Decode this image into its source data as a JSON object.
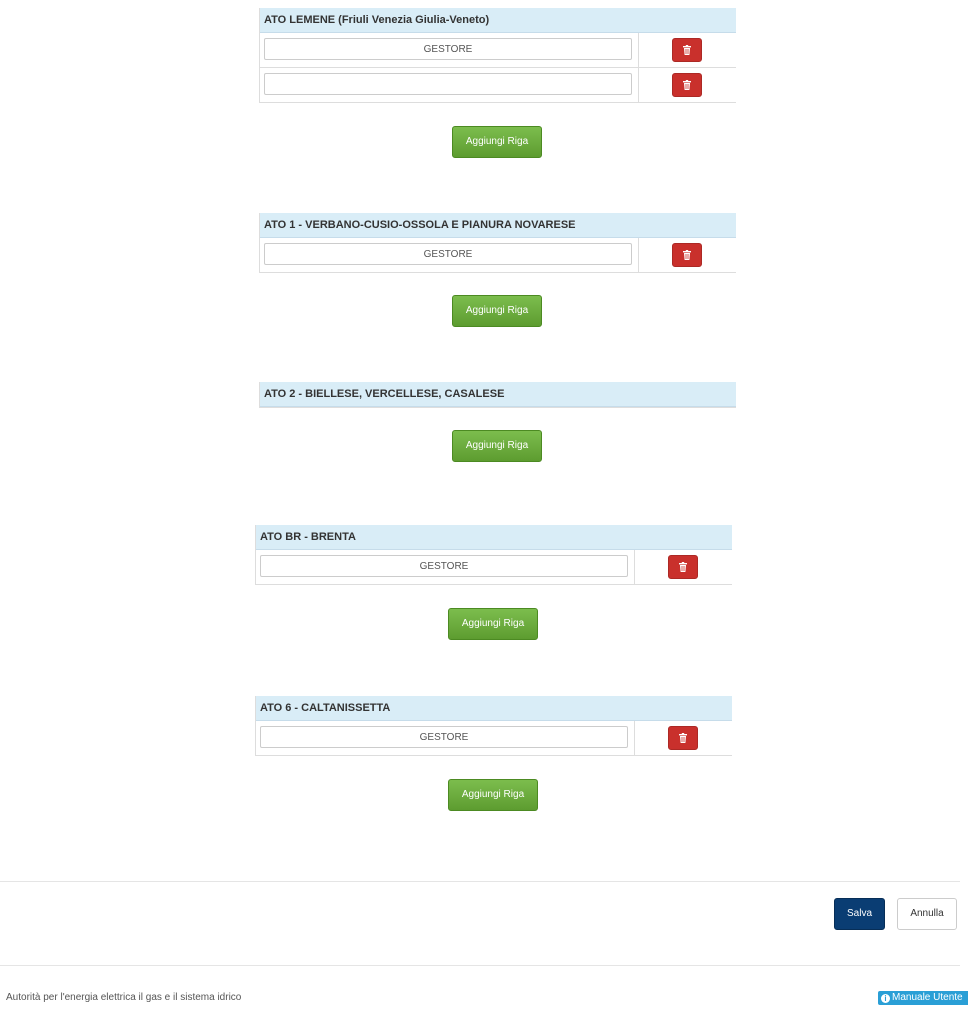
{
  "sections": [
    {
      "title": "ATO LEMENE (Friuli Venezia Giulia-Veneto)",
      "rows": [
        {
          "value": "GESTORE"
        },
        {
          "value": ""
        }
      ],
      "add_label": "Aggiungi Riga"
    },
    {
      "title": "ATO 1 - VERBANO-CUSIO-OSSOLA E PIANURA NOVARESE",
      "rows": [
        {
          "value": "GESTORE"
        }
      ],
      "add_label": "Aggiungi Riga"
    },
    {
      "title": "ATO 2 - BIELLESE, VERCELLESE, CASALESE",
      "rows": [],
      "add_label": "Aggiungi Riga"
    },
    {
      "title": "ATO BR - BRENTA",
      "rows": [
        {
          "value": "GESTORE"
        }
      ],
      "add_label": "Aggiungi Riga"
    },
    {
      "title": "ATO 6 - CALTANISSETTA",
      "rows": [
        {
          "value": "GESTORE"
        }
      ],
      "add_label": "Aggiungi Riga"
    }
  ],
  "actions": {
    "save_label": "Salva",
    "cancel_label": "Annulla"
  },
  "footer": {
    "text": "Autorità per l'energia elettrica il gas e il sistema idrico",
    "manual_label": "Manuale Utente"
  },
  "colors": {
    "header_bg": "#d9edf7",
    "trash_btn": "#c9302c",
    "add_btn": "#6aa83c",
    "save_btn": "#0a3d73",
    "manual_btn": "#2a9fd6"
  },
  "icons": {
    "trash": "trash-icon",
    "info": "info-icon"
  }
}
